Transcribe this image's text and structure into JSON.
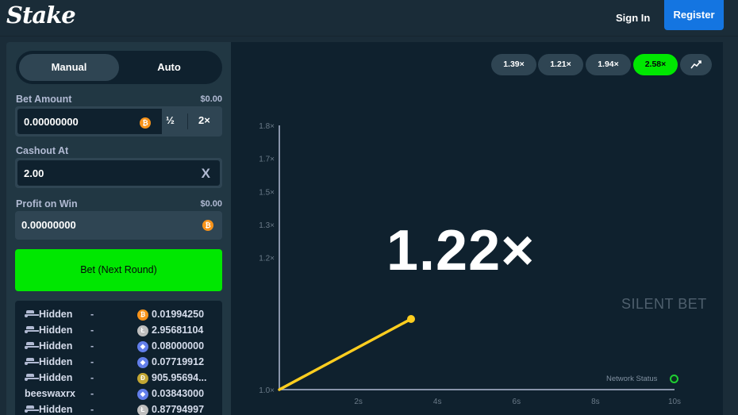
{
  "header": {
    "logo": "Stake",
    "sign_in": "Sign In",
    "register": "Register"
  },
  "sidebar": {
    "tabs": [
      {
        "label": "Manual",
        "active": true
      },
      {
        "label": "Auto",
        "active": false
      }
    ],
    "bet_amount": {
      "label": "Bet Amount",
      "usd": "$0.00",
      "value": "0.00000000",
      "currency_icon": "bitcoin-icon",
      "half": "½",
      "double": "2×"
    },
    "cashout": {
      "label": "Cashout At",
      "value": "2.00",
      "clear": "X"
    },
    "profit": {
      "label": "Profit on Win",
      "usd": "$0.00",
      "value": "0.00000000",
      "currency_icon": "bitcoin-icon"
    },
    "bet_button": "Bet (Next Round)",
    "players": [
      {
        "name": "Hidden",
        "hidden": true,
        "status": "-",
        "coin": "btc",
        "amount": "0.01994250"
      },
      {
        "name": "Hidden",
        "hidden": true,
        "status": "-",
        "coin": "ltc",
        "amount": "2.95681104"
      },
      {
        "name": "Hidden",
        "hidden": true,
        "status": "-",
        "coin": "eth",
        "amount": "0.08000000"
      },
      {
        "name": "Hidden",
        "hidden": true,
        "status": "-",
        "coin": "eth",
        "amount": "0.07719912"
      },
      {
        "name": "Hidden",
        "hidden": true,
        "status": "-",
        "coin": "doge",
        "amount": "905.95694..."
      },
      {
        "name": "beeswaxrx",
        "hidden": false,
        "status": "-",
        "coin": "eth",
        "amount": "0.03843000"
      },
      {
        "name": "Hidden",
        "hidden": true,
        "status": "-",
        "coin": "ltc",
        "amount": "0.87794997"
      }
    ]
  },
  "game": {
    "history": [
      "1.39×",
      "1.21×",
      "1.94×",
      "2.58×"
    ],
    "history_win": [
      false,
      false,
      false,
      true
    ],
    "multiplier": "1.22×",
    "watermark": "SILENT BET",
    "network_status": "Network Status",
    "colors": {
      "accent": "#00e701",
      "curve": "#ffce1f",
      "brand_blue": "#1475e1"
    }
  },
  "chart_data": {
    "type": "line",
    "y_ticks": [
      "1.8×",
      "1.7×",
      "1.5×",
      "1.3×",
      "1.2×",
      "1.0×"
    ],
    "x_ticks": [
      "2s",
      "4s",
      "6s",
      "8s",
      "10s"
    ],
    "ylim": [
      1.0,
      1.8
    ],
    "xlim": [
      0,
      10
    ],
    "series": [
      {
        "x": [
          0,
          3.35
        ],
        "y": [
          1.0,
          1.22
        ]
      }
    ]
  }
}
